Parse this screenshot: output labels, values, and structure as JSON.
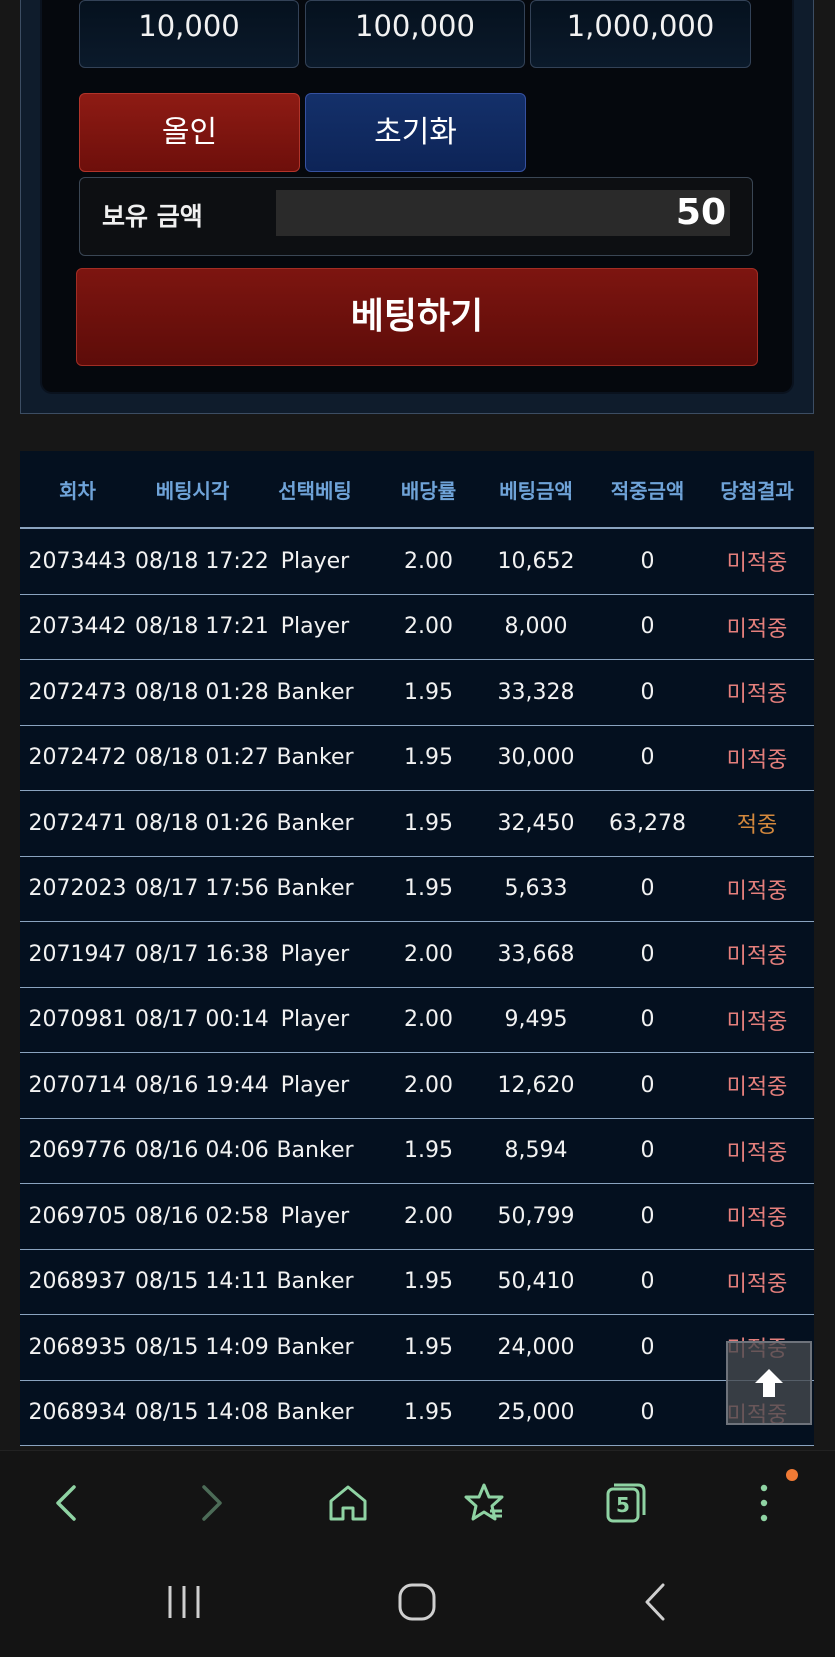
{
  "chips": [
    "10,000",
    "100,000",
    "1,000,000"
  ],
  "actions": {
    "allin": "올인",
    "reset": "초기화",
    "bet": "베팅하기"
  },
  "balance": {
    "label": "보유 금액",
    "value": "50"
  },
  "history": {
    "headers": [
      "회차",
      "베팅시각",
      "선택베팅",
      "배당률",
      "베팅금액",
      "적중금액",
      "당첨결과"
    ],
    "rows": [
      [
        "2073443",
        "08/18 17:22",
        "Player",
        "2.00",
        "10,652",
        "0",
        "미적중"
      ],
      [
        "2073442",
        "08/18 17:21",
        "Player",
        "2.00",
        "8,000",
        "0",
        "미적중"
      ],
      [
        "2072473",
        "08/18 01:28",
        "Banker",
        "1.95",
        "33,328",
        "0",
        "미적중"
      ],
      [
        "2072472",
        "08/18 01:27",
        "Banker",
        "1.95",
        "30,000",
        "0",
        "미적중"
      ],
      [
        "2072471",
        "08/18 01:26",
        "Banker",
        "1.95",
        "32,450",
        "63,278",
        "적중"
      ],
      [
        "2072023",
        "08/17 17:56",
        "Banker",
        "1.95",
        "5,633",
        "0",
        "미적중"
      ],
      [
        "2071947",
        "08/17 16:38",
        "Player",
        "2.00",
        "33,668",
        "0",
        "미적중"
      ],
      [
        "2070981",
        "08/17 00:14",
        "Player",
        "2.00",
        "9,495",
        "0",
        "미적중"
      ],
      [
        "2070714",
        "08/16 19:44",
        "Player",
        "2.00",
        "12,620",
        "0",
        "미적중"
      ],
      [
        "2069776",
        "08/16 04:06",
        "Banker",
        "1.95",
        "8,594",
        "0",
        "미적중"
      ],
      [
        "2069705",
        "08/16 02:58",
        "Player",
        "2.00",
        "50,799",
        "0",
        "미적중"
      ],
      [
        "2068937",
        "08/15 14:11",
        "Banker",
        "1.95",
        "50,410",
        "0",
        "미적중"
      ],
      [
        "2068935",
        "08/15 14:09",
        "Banker",
        "1.95",
        "24,000",
        "0",
        "미적중"
      ],
      [
        "2068934",
        "08/15 14:08",
        "Banker",
        "1.95",
        "25,000",
        "0",
        "미적중"
      ]
    ]
  },
  "browser": {
    "tab_count": "5"
  },
  "colors": {
    "miss": "#e57f7c",
    "hit": "#d3883d",
    "header": "#6fa3d8",
    "nav_icon": "#8fd3a3"
  }
}
